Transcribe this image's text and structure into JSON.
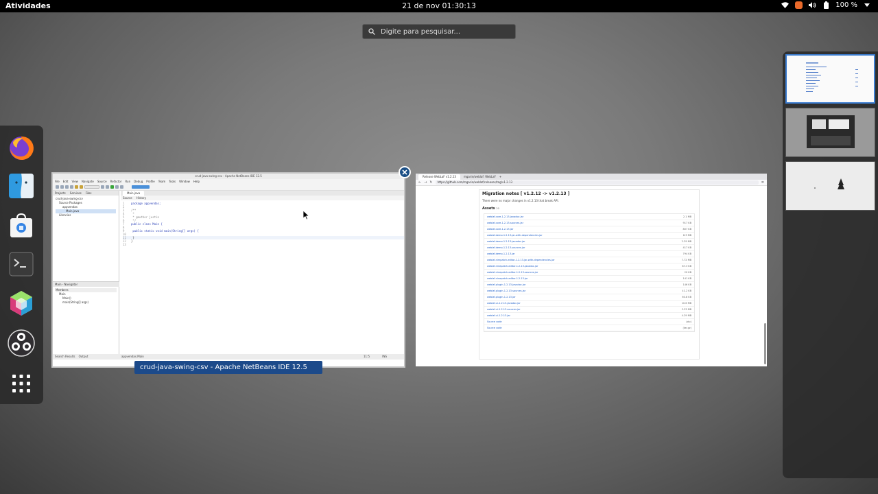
{
  "topbar": {
    "activities": "Atividades",
    "clock": "21 de nov  01:30:13",
    "battery": "100 %"
  },
  "search": {
    "placeholder": "Digite para pesquisar..."
  },
  "dash": {
    "apps": [
      "firefox-icon",
      "files-icon",
      "software-icon",
      "terminal-icon",
      "netbeans-icon",
      "obs-icon",
      "app-grid-icon"
    ]
  },
  "netbeans": {
    "title": "crud-java-swing-csv - Apache NetBeans IDE 12.5",
    "caption": "crud-java-swing-csv - Apache NetBeans IDE 12.5",
    "menu": [
      "File",
      "Edit",
      "View",
      "Navigate",
      "Source",
      "Refactor",
      "Run",
      "Debug",
      "Profile",
      "Team",
      "Tools",
      "Window",
      "Help"
    ],
    "left_tabs": [
      "Projects",
      "Services",
      "Files"
    ],
    "tree": [
      "crud-java-swing-csv",
      "Source Packages",
      "appvendas",
      "Main.java",
      "Libraries"
    ],
    "navigator_title": "Main - Navigator",
    "navigator_items": [
      "Members",
      "Main",
      "Main()",
      "main(String[] args)"
    ],
    "editor_tab": "Main.java",
    "editor_subtabs": [
      "Source",
      "History"
    ],
    "code": [
      "package appvendas;",
      "",
      "/**",
      " *",
      " * @author justin",
      " */",
      "public class Main {",
      "",
      "    public static void main(String[] args) {",
      "",
      "    }",
      "}",
      ""
    ],
    "status_left": "appvendas.Main",
    "bottom_tabs": [
      "Search Results",
      "Output"
    ],
    "position": "11:5",
    "mode": "INS"
  },
  "firefox": {
    "tabs": [
      "Release WebLaF v1.2.13",
      "mgarin/weblaf: WebLaF"
    ],
    "url": "https://github.com/mgarin/weblaf/releases/tag/v1.2.13",
    "heading": "Migration notes [ v1.2.12 -> v1.2.13 ]",
    "note": "There were no major changes in v1.2.13 that break API.",
    "assets_label": "Assets",
    "assets_count": "20",
    "assets": [
      {
        "name": "weblaf-core-1.2.13-javadoc.jar",
        "size": "2.1 MB"
      },
      {
        "name": "weblaf-core-1.2.13-sources.jar",
        "size": "917 KB"
      },
      {
        "name": "weblaf-core-1.2.13.jar",
        "size": "807 KB"
      },
      {
        "name": "weblaf-demo-1.2.13-jar-with-dependencies.jar",
        "size": "8.3 MB"
      },
      {
        "name": "weblaf-demo-1.2.13-javadoc.jar",
        "size": "2.39 MB"
      },
      {
        "name": "weblaf-demo-1.2.13-sources.jar",
        "size": "417 KB"
      },
      {
        "name": "weblaf-demo-1.2.13.jar",
        "size": "794 KB"
      },
      {
        "name": "weblaf-nimpatch-editor-1.2.13-jar-with-dependencies.jar",
        "size": "7.72 MB"
      },
      {
        "name": "weblaf-ninepatch-editor-1.2.13-javadoc.jar",
        "size": "87.3 KB"
      },
      {
        "name": "weblaf-ninepatch-editor-1.2.13-sources.jar",
        "size": "20 KB"
      },
      {
        "name": "weblaf-ninepatch-editor-1.2.13.jar",
        "size": "141 KB"
      },
      {
        "name": "weblaf-plugin-1.2.13-javadoc.jar",
        "size": "146 KB"
      },
      {
        "name": "weblaf-plugin-1.2.13-sources.jar",
        "size": "41.2 KB"
      },
      {
        "name": "weblaf-plugin-1.2.13.jar",
        "size": "60.8 KB"
      },
      {
        "name": "weblaf-ui-1.2.13-javadoc.jar",
        "size": "10.6 MB"
      },
      {
        "name": "weblaf-ui-1.2.13-sources.jar",
        "size": "3.33 MB"
      },
      {
        "name": "weblaf-ui-1.2.13.jar",
        "size": "4.29 MB"
      },
      {
        "name": "Source code",
        "size": "(zip)"
      },
      {
        "name": "Source code",
        "size": "(tar.gz)"
      }
    ]
  }
}
